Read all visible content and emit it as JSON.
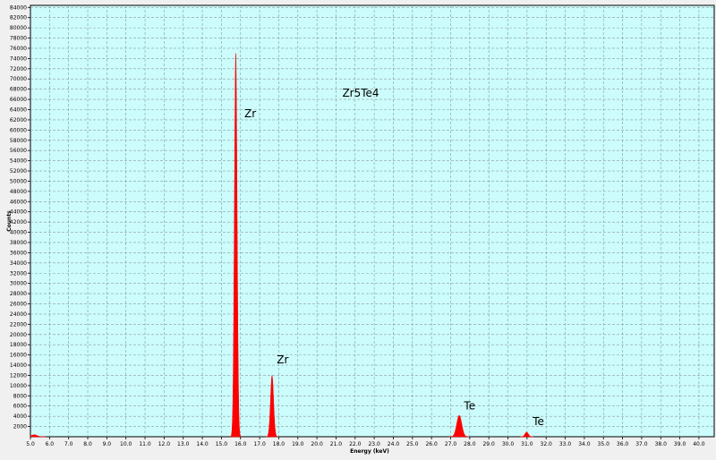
{
  "chart_data": {
    "type": "area",
    "title": "Zr5Te4",
    "xlabel": "Energy (keV)",
    "ylabel": "Counts",
    "xlim": [
      5.0,
      40.8
    ],
    "ylim": [
      0,
      84400
    ],
    "x_ticks": [
      "5.0",
      "6.0",
      "7.0",
      "8.0",
      "9.0",
      "10.0",
      "11.0",
      "12.0",
      "13.0",
      "14.0",
      "15.0",
      "16.0",
      "17.0",
      "18.0",
      "19.0",
      "20.0",
      "21.0",
      "22.0",
      "23.0",
      "24.0",
      "25.0",
      "26.0",
      "27.0",
      "28.0",
      "29.0",
      "30.0",
      "31.0",
      "32.0",
      "33.0",
      "34.0",
      "35.0",
      "36.0",
      "37.0",
      "38.0",
      "39.0",
      "40.0"
    ],
    "y_ticks": [
      "2000",
      "4000",
      "6000",
      "8000",
      "10000",
      "12000",
      "14000",
      "16000",
      "18000",
      "20000",
      "22000",
      "24000",
      "26000",
      "28000",
      "30000",
      "32000",
      "34000",
      "36000",
      "38000",
      "40000",
      "42000",
      "44000",
      "46000",
      "48000",
      "50000",
      "52000",
      "54000",
      "56000",
      "58000",
      "60000",
      "62000",
      "64000",
      "66000",
      "68000",
      "70000",
      "72000",
      "74000",
      "76000",
      "78000",
      "80000",
      "82000",
      "84000"
    ],
    "grid": true,
    "colors": {
      "plot_bg": "#ccfcfc",
      "fill": "#ff0000",
      "grid": "#8a9a9a"
    },
    "series": [
      {
        "peaks": [
          {
            "center": 15.75,
            "height": 75000,
            "width": 0.07
          },
          {
            "center": 17.65,
            "height": 12000,
            "width": 0.08
          },
          {
            "center": 27.45,
            "height": 4200,
            "width": 0.13
          },
          {
            "center": 30.98,
            "height": 900,
            "width": 0.09
          },
          {
            "center": 5.2,
            "height": 400,
            "width": 0.15
          }
        ]
      }
    ],
    "annotations": [
      {
        "text": "Zr",
        "x": 16.2,
        "y": 62500
      },
      {
        "text": "Zr",
        "x": 17.9,
        "y": 14400
      },
      {
        "text": "Te",
        "x": 27.7,
        "y": 5300
      },
      {
        "text": "Te",
        "x": 31.3,
        "y": 2300
      }
    ]
  }
}
